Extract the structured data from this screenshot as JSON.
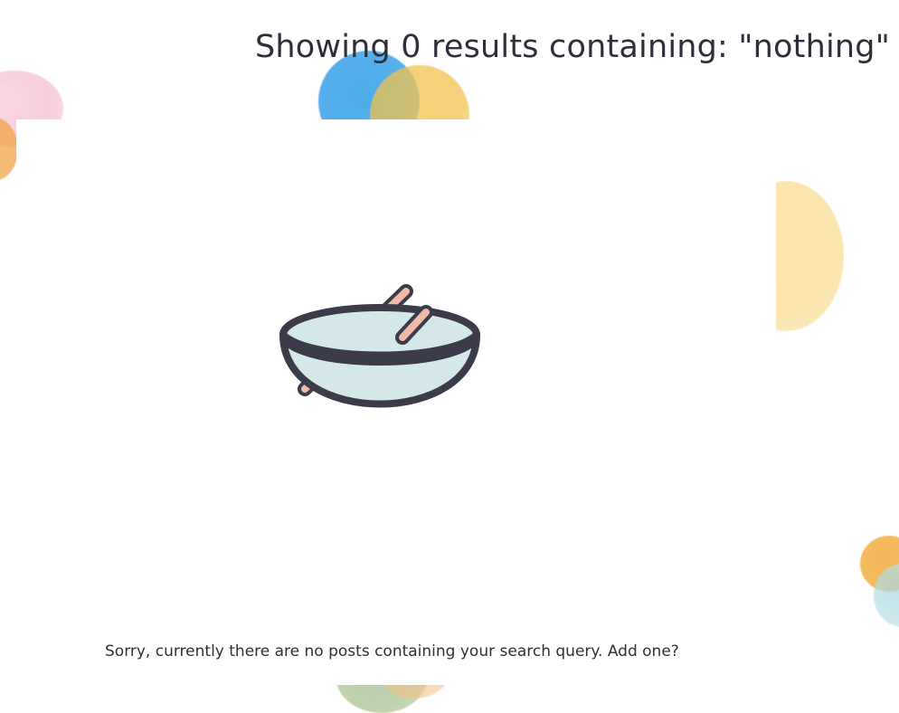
{
  "header": {
    "title": "Showing 0 results containing: \"nothing\""
  },
  "empty_state": {
    "message": "Sorry, currently there are no posts containing your search query.",
    "add_link": "Add one?",
    "illustration_icon": "mixing-bowl-icon"
  },
  "colors": {
    "text": "#2f2f3a",
    "bowl_fill": "#d5e8e9",
    "bowl_outline": "#3b3b4a",
    "spoon_fill": "#f1b9a8",
    "background": "#ffffff"
  }
}
